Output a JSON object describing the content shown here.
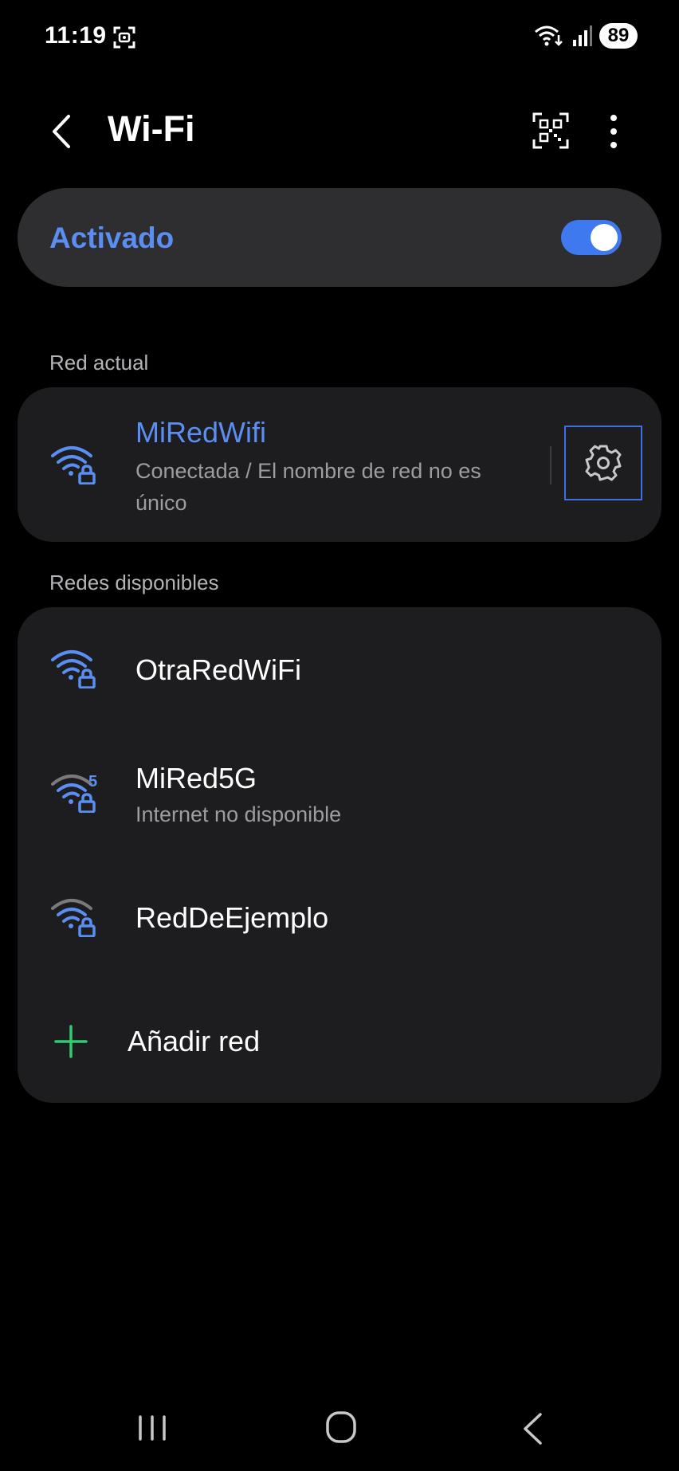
{
  "status_bar": {
    "time": "11:19",
    "battery": "89",
    "icons": [
      "screenshot-icon",
      "wifi-calling-icon",
      "signal-icon",
      "battery-icon"
    ]
  },
  "header": {
    "title": "Wi-Fi",
    "back_icon": "chevron-left-icon",
    "qr_icon": "qr-code-scan-icon",
    "more_icon": "more-vertical-icon"
  },
  "wifi_toggle": {
    "label": "Activado",
    "state": "on"
  },
  "current_network": {
    "section_label": "Red actual",
    "name": "MiRedWifi",
    "status_line1": "Conectada / El nombre de red no es",
    "status_line2": "único",
    "settings_icon": "gear-icon"
  },
  "available_networks": {
    "section_label": "Redes disponibles",
    "items": [
      {
        "name": "OtraRedWiFi",
        "status": "",
        "signal": "full",
        "band_badge": ""
      },
      {
        "name": "MiRed5G",
        "status": "Internet no disponible",
        "signal": "medium",
        "band_badge": "5"
      },
      {
        "name": "RedDeEjemplo",
        "status": "",
        "signal": "medium",
        "band_badge": ""
      }
    ],
    "add_label": "Añadir red"
  },
  "colors": {
    "background": "#000000",
    "card": "#1d1d1f",
    "toggle_card": "#2e2e30",
    "accent_blue": "#5b8ef2",
    "add_green": "#2ecc71"
  },
  "nav_bar": {
    "icons": [
      "recent-apps-icon",
      "home-icon",
      "back-icon"
    ]
  }
}
